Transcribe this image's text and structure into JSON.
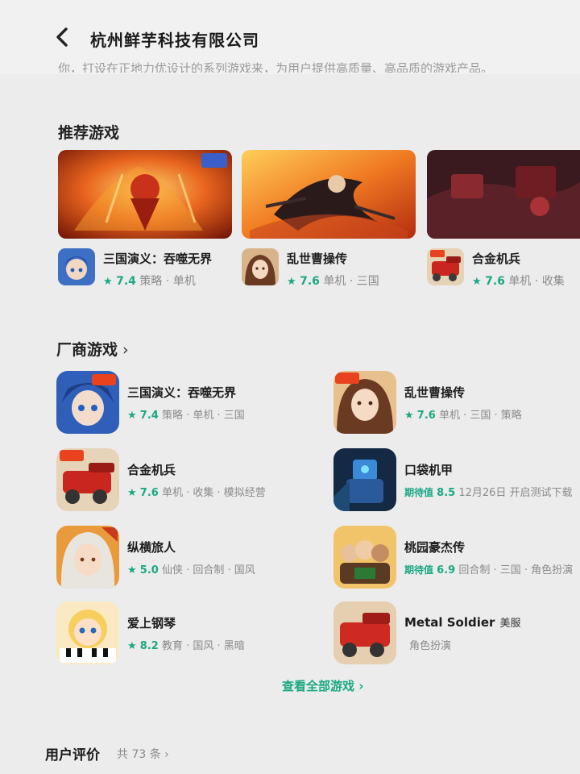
{
  "header": {
    "title": "杭州鲜芋科技有限公司",
    "back_icon": "chevron-left-icon"
  },
  "intro": {
    "text": "你，打设在正地力优设计的系列游戏来，为用户提供高质量、高品质的游戏产品。"
  },
  "recommended": {
    "title": "推荐游戏",
    "items": [
      {
        "name": "三国演义：吞噬无界",
        "score": "7.4",
        "tags": "策略 · 单机"
      },
      {
        "name": "乱世曹操传",
        "score": "7.6",
        "tags": "单机 · 三国"
      },
      {
        "name": "合金机兵",
        "score": "7.6",
        "tags": "单机 · 收集"
      }
    ]
  },
  "vendor_games": {
    "title": "厂商游戏",
    "items": [
      {
        "name": "三国演义：吞噬无界",
        "score": "7.4",
        "tags": "策略 · 单机 · 三国"
      },
      {
        "name": "乱世曹操传",
        "score": "7.6",
        "tags": "单机 · 三国 · 策略"
      },
      {
        "name": "合金机兵",
        "score": "7.6",
        "tags": "单机 · 收集 · 模拟经营"
      },
      {
        "name": "口袋机甲",
        "expect_label": "期待值",
        "expect_value": "8.5",
        "tags": "12月26日 开启测试下载"
      },
      {
        "name": "纵横旅人",
        "score": "5.0",
        "tags": "仙侠 · 回合制 · 国风"
      },
      {
        "name": "桃园豪杰传",
        "expect_label": "期待值",
        "expect_value": "6.9",
        "tags": "回合制 · 三国 · 角色扮演"
      },
      {
        "name": "爱上钢琴",
        "score": "8.2",
        "tags": "教育 · 国风 · 黑暗"
      },
      {
        "name": "Metal Soldier",
        "tag": "美服",
        "tags": "角色扮演"
      }
    ]
  },
  "view_all": "查看全部游戏 ›",
  "reviews": {
    "title": "用户评价",
    "count": "共 73 条 ›"
  },
  "colors": {
    "accent": "#1aa882",
    "background": "#ececec"
  }
}
